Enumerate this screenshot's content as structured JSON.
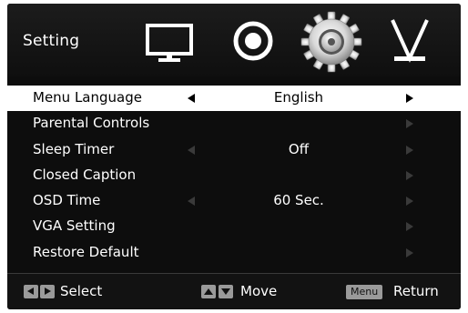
{
  "header": {
    "title": "Setting",
    "categories": [
      {
        "name": "picture",
        "icon": "tv-icon"
      },
      {
        "name": "sound",
        "icon": "speaker-icon"
      },
      {
        "name": "setting",
        "icon": "gear-icon",
        "selected": true
      },
      {
        "name": "channel",
        "icon": "antenna-icon"
      }
    ]
  },
  "menu": {
    "items": [
      {
        "label": "Menu Language",
        "value": "English",
        "selected": true
      },
      {
        "label": "Parental Controls",
        "value": ""
      },
      {
        "label": "Sleep Timer",
        "value": "Off"
      },
      {
        "label": "Closed Caption",
        "value": ""
      },
      {
        "label": "OSD Time",
        "value": "60 Sec."
      },
      {
        "label": "VGA Setting",
        "value": ""
      },
      {
        "label": "Restore Default",
        "value": ""
      }
    ]
  },
  "footer": {
    "select_label": "Select",
    "move_label": "Move",
    "menu_key_label": "Menu",
    "return_label": "Return"
  },
  "colors": {
    "background": "#0d0d0d",
    "selected_row": "#ffffff",
    "dim_arrow": "#3a3a3a",
    "key_bg": "#9a9a9a"
  }
}
